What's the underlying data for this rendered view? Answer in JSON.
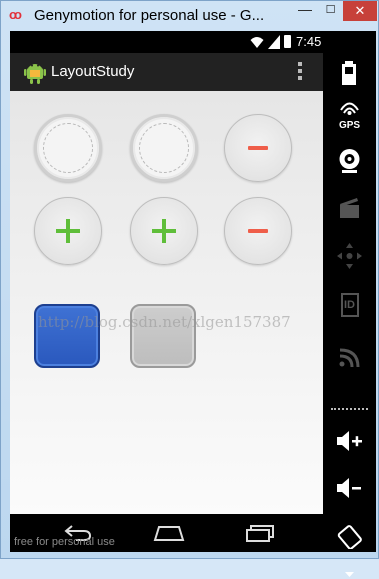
{
  "window": {
    "title": "Genymotion for personal use - G...",
    "app_icon_glyph": "oo",
    "min_glyph": "—",
    "max_glyph": "☐",
    "close_glyph": "✕"
  },
  "statusbar": {
    "time": "7:45"
  },
  "actionbar": {
    "title": "LayoutStudy",
    "app_icon": "android-icon",
    "overflow_icon": "overflow-menu-icon"
  },
  "content": {
    "watermark": "http://blog.csdn.net/xlgen157387",
    "buttons": [
      {
        "row": 1,
        "col": 1,
        "style": "ring",
        "symbol": ""
      },
      {
        "row": 1,
        "col": 2,
        "style": "ring",
        "symbol": ""
      },
      {
        "row": 1,
        "col": 3,
        "style": "round",
        "symbol": "minus"
      },
      {
        "row": 2,
        "col": 1,
        "style": "round",
        "symbol": "plus"
      },
      {
        "row": 2,
        "col": 2,
        "style": "round",
        "symbol": "plus"
      },
      {
        "row": 2,
        "col": 3,
        "style": "round",
        "symbol": "minus"
      },
      {
        "row": 3,
        "col": 1,
        "style": "square-blue",
        "symbol": ""
      },
      {
        "row": 3,
        "col": 2,
        "style": "square-gray",
        "symbol": ""
      }
    ],
    "colors": {
      "minus": "#ef5e4a",
      "plus": "#5fbe3a",
      "blue_square": "#2f60c8",
      "gray_square": "#c4c4c4"
    }
  },
  "navbar": {
    "free_text": "free for personal use"
  },
  "side_panel": {
    "gps_label": "GPS",
    "id_label": "ID",
    "items": [
      "battery-icon",
      "gps-icon",
      "camera-icon",
      "clapboard-icon",
      "dpad-icon",
      "id-icon",
      "cast-icon",
      "volume-up-icon",
      "volume-down-icon",
      "rotate-icon",
      "scroll-down-icon"
    ]
  }
}
